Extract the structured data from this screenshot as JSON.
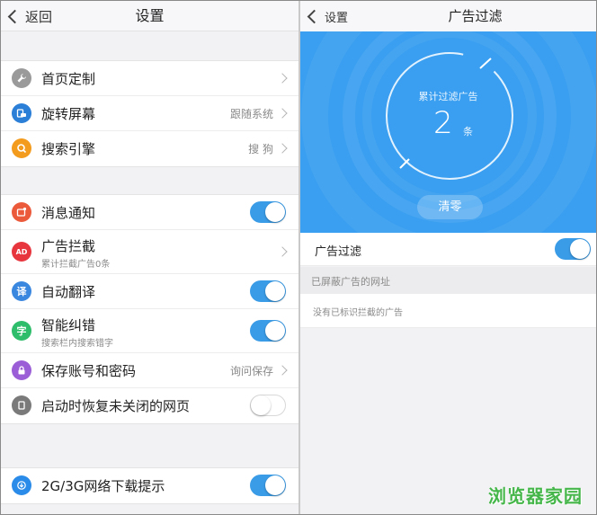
{
  "left": {
    "back_label": "返回",
    "title": "设置",
    "groups": [
      {
        "items": [
          {
            "label": "首页定制",
            "value": "",
            "icon": "wrench-icon",
            "color": "#9a9a9a"
          },
          {
            "label": "旋转屏幕",
            "value": "跟随系统",
            "icon": "rotate-screen-icon",
            "color": "#2b7fd6"
          },
          {
            "label": "搜索引擎",
            "value": "搜 狗",
            "icon": "search-icon",
            "color": "#f39b1c"
          }
        ]
      },
      {
        "items": [
          {
            "label": "消息通知",
            "icon": "notification-icon",
            "color": "#ec5a3c",
            "toggle": "on"
          },
          {
            "label": "广告拦截",
            "sub": "累计拦截广告0条",
            "icon": "ad-block-icon",
            "icon_text": "AD",
            "color": "#e8363f"
          },
          {
            "label": "自动翻译",
            "icon": "translate-icon",
            "icon_text": "译",
            "color": "#3a87e0",
            "toggle": "on"
          },
          {
            "label": "智能纠错",
            "sub": "搜索栏内搜索错字",
            "icon": "spell-check-icon",
            "icon_text": "字",
            "color": "#2ebd6a",
            "toggle": "on"
          },
          {
            "label": "保存账号和密码",
            "value": "询问保存",
            "icon": "lock-icon",
            "color": "#9b5ed6"
          },
          {
            "label": "启动时恢复未关闭的网页",
            "icon": "restore-page-icon",
            "color": "#7a7a7a",
            "toggle": "off"
          }
        ]
      },
      {
        "items": [
          {
            "label": "2G/3G网络下载提示",
            "icon": "download-icon",
            "color": "#2b8be8",
            "toggle": "on"
          }
        ]
      }
    ]
  },
  "right": {
    "back_label": "设置",
    "title": "广告过滤",
    "hero": {
      "label": "累计过滤广告",
      "count": "2",
      "unit": "条",
      "clear_label": "清零",
      "bg_color": "#3a9ff0"
    },
    "filter_row": {
      "label": "广告过滤",
      "toggle": "on"
    },
    "section_label": "已屏蔽广告的网址",
    "empty_label": "没有已标识拦截的广告"
  },
  "watermark": "浏览器家园",
  "colors": {
    "toggle_on": "#3a9be6",
    "accent": "#3a9ff0",
    "watermark": "#45b649"
  }
}
